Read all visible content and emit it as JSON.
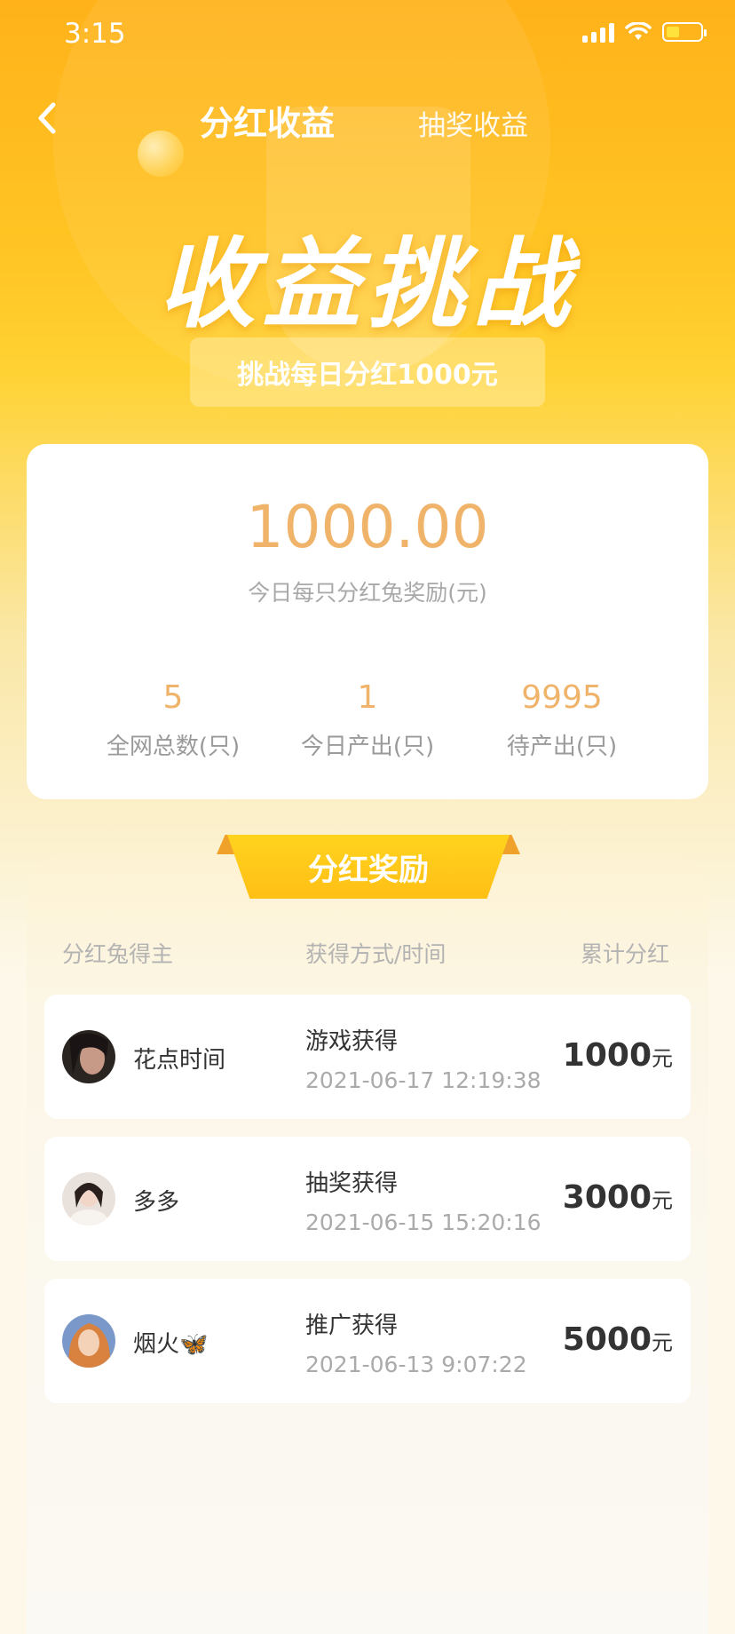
{
  "status_bar": {
    "time": "3:15"
  },
  "nav": {
    "active_tab": "分红收益",
    "inactive_tab": "抽奖收益"
  },
  "hero": {
    "title": "收益挑战",
    "subtitle": "挑战每日分红1000元"
  },
  "summary": {
    "amount": "1000.00",
    "amount_label": "今日每只分红兔奖励(元)",
    "stats": [
      {
        "value": "5",
        "label": "全网总数(只)"
      },
      {
        "value": "1",
        "label": "今日产出(只)"
      },
      {
        "value": "9995",
        "label": "待产出(只)"
      }
    ]
  },
  "rewards": {
    "ribbon_title": "分红奖励",
    "columns": [
      "分红兔得主",
      "获得方式/时间",
      "累计分红"
    ],
    "rows": [
      {
        "name": "花点时间",
        "method": "游戏获得",
        "time": "2021-06-17 12:19:38",
        "amount": "1000",
        "unit": "元"
      },
      {
        "name": "多多",
        "method": "抽奖获得",
        "time": "2021-06-15 15:20:16",
        "amount": "3000",
        "unit": "元"
      },
      {
        "name": "烟火🦋",
        "method": "推广获得",
        "time": "2021-06-13 9:07:22",
        "amount": "5000",
        "unit": "元"
      }
    ]
  },
  "colors": {
    "accent_orange": "#f0b36a",
    "bg_yellow": "#ffc423",
    "ribbon_yellow": "#ffd31e"
  }
}
